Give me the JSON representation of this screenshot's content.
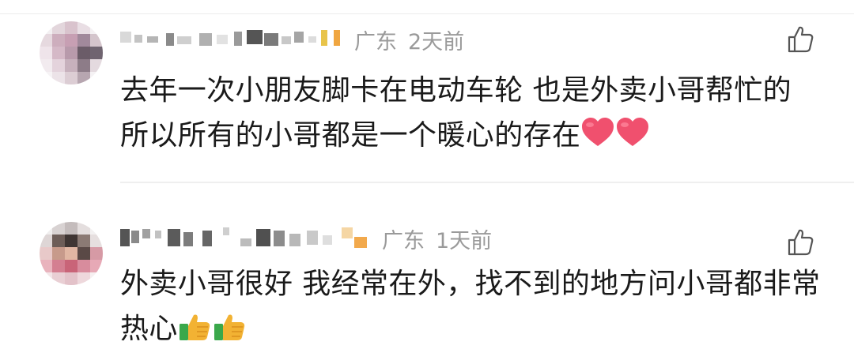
{
  "comments": [
    {
      "location": "广东",
      "time": "2天前",
      "text": "去年一次小朋友脚卡在电动车轮 也是外卖小哥帮忙的 所以所有的小哥都是一个暖心的存在",
      "emoji": [
        "red-heart",
        "red-heart"
      ],
      "icons": {
        "like": "thumbs-up-outline-icon"
      }
    },
    {
      "location": "广东",
      "time": "1天前",
      "text": "外卖小哥很好 我经常在外，找不到的地方问小哥都非常热心",
      "emoji": [
        "thumbs-up-emoji",
        "thumbs-up-emoji"
      ],
      "icons": {
        "like": "thumbs-up-outline-icon"
      }
    }
  ],
  "colors": {
    "meta_text": "#9a9a9a",
    "body_text": "#1a1a1a",
    "heart": "#f0506e",
    "thumb": "#f2b233",
    "divider": "#efefef"
  }
}
